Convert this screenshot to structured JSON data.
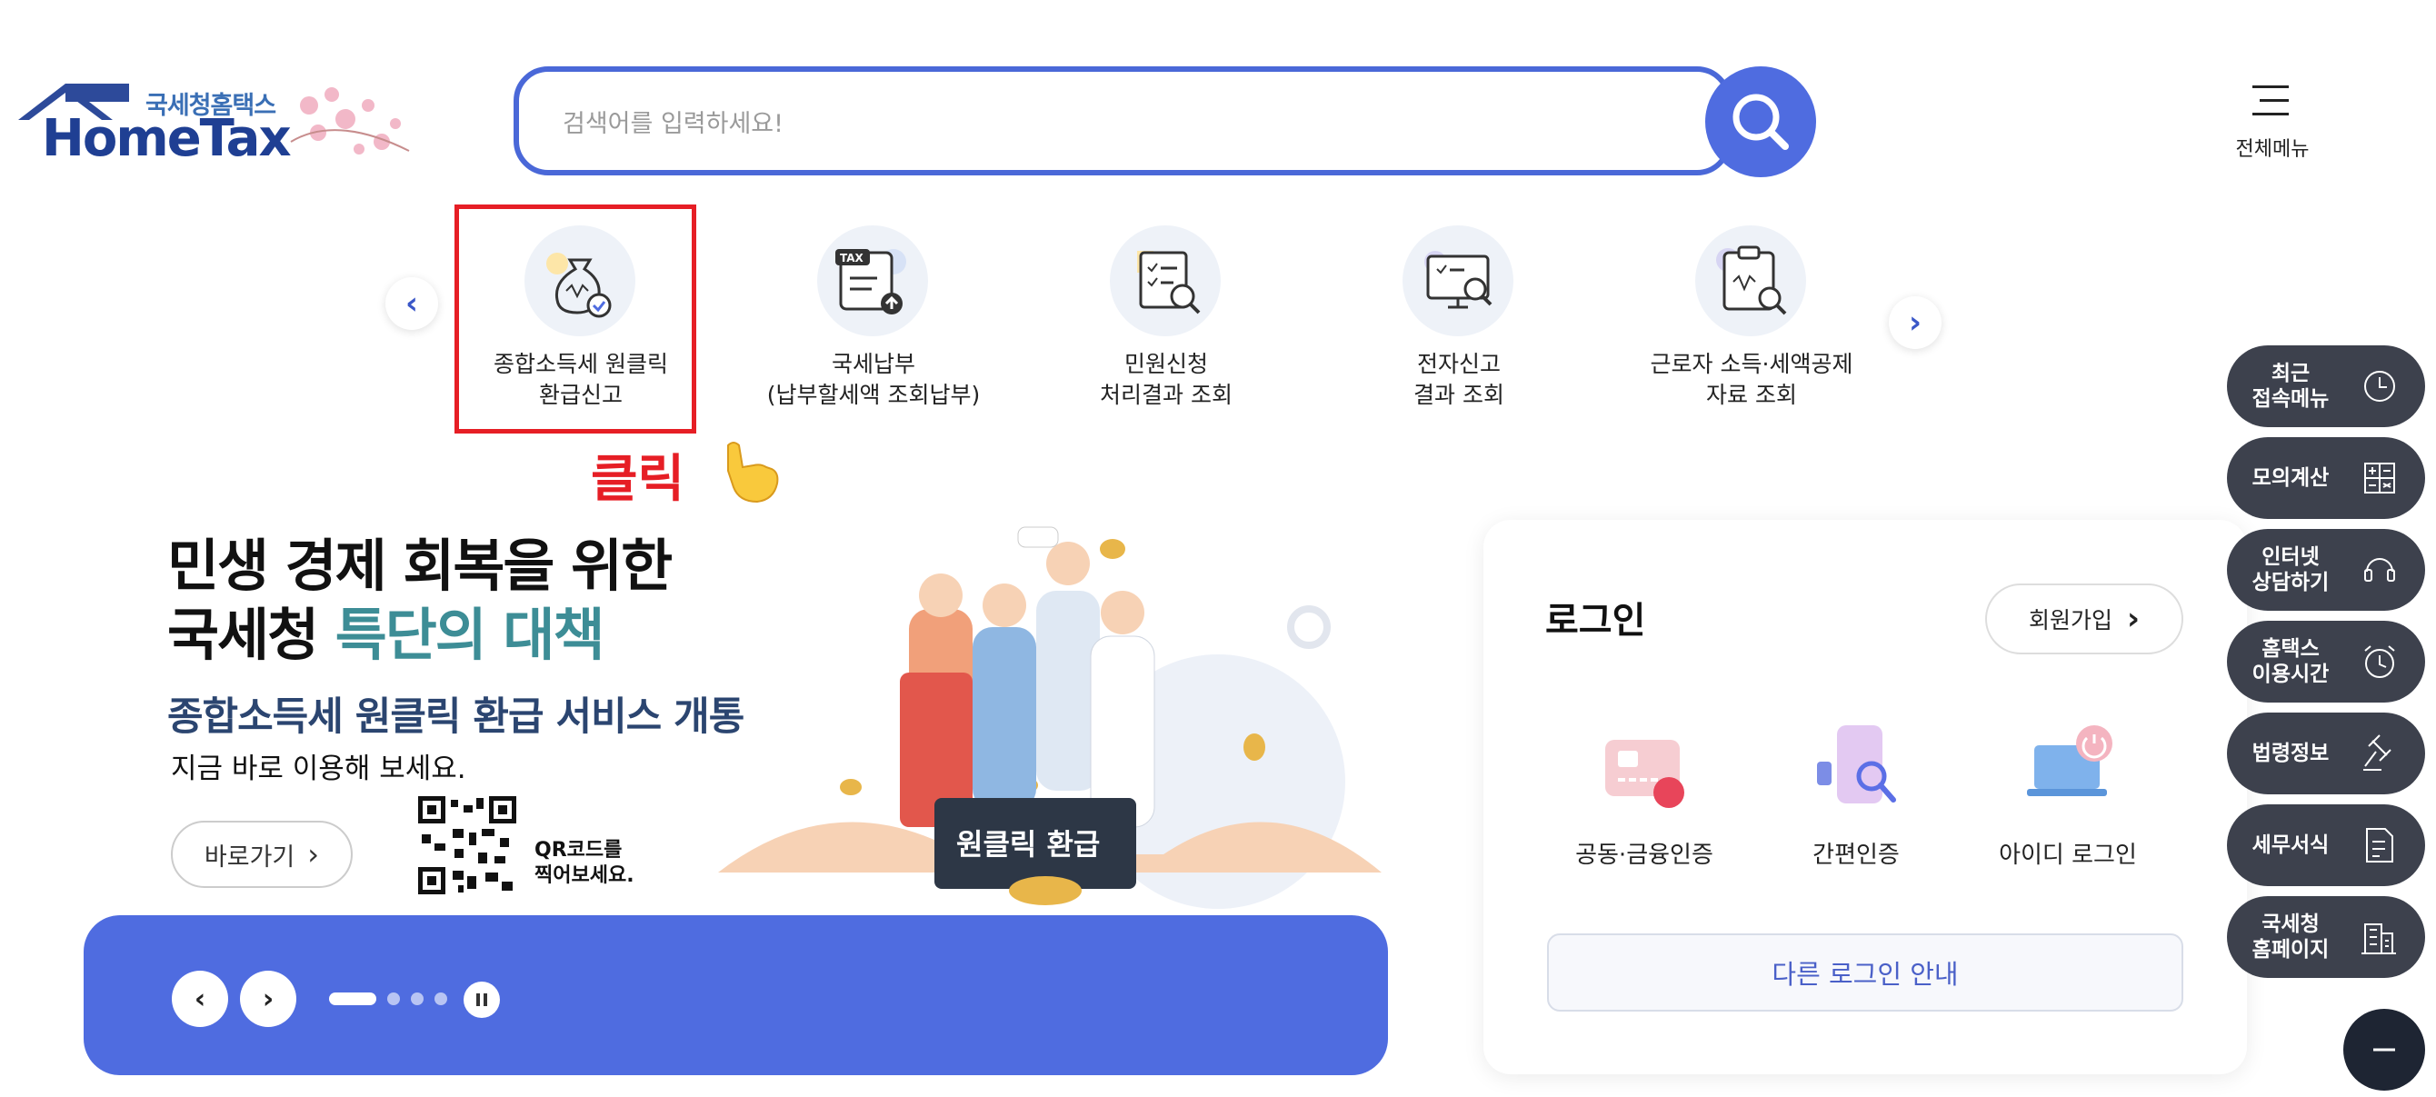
{
  "header": {
    "logo_small": "국세청홈택스",
    "logo_big": "HomeTax",
    "search_placeholder": "검색어를 입력하세요!",
    "full_menu_label": "전체메뉴"
  },
  "quick_menu": {
    "items": [
      {
        "line1": "종합소득세 원클릭",
        "line2": "환급신고",
        "icon": "money-bag-icon"
      },
      {
        "line1": "국세납부",
        "line2": "(납부할세액 조회납부)",
        "icon": "tax-upload-icon"
      },
      {
        "line1": "민원신청",
        "line2": "처리결과 조회",
        "icon": "document-search-icon"
      },
      {
        "line1": "전자신고",
        "line2": "결과 조회",
        "icon": "monitor-search-icon"
      },
      {
        "line1": "근로자 소득·세액공제",
        "line2": "자료 조회",
        "icon": "clipboard-search-icon"
      }
    ],
    "click_annotation": "클릭",
    "highlight_color": "#e61e25"
  },
  "banner": {
    "title_line1": "민생 경제 회복을 위한",
    "title_line2_a": "국세청 ",
    "title_line2_b": "특단의 대책",
    "subtitle": "종합소득세 원클릭 환급 서비스 개통",
    "description": "지금 바로 이용해 보세요.",
    "go_button": "바로가기",
    "qr_text_line1": "QR코드를",
    "qr_text_line2": "찍어보세요.",
    "sign_text": "원클릭 환급",
    "slide_index": 1,
    "slide_count": 4,
    "accent_color": "#4f6ce0"
  },
  "login": {
    "title": "로그인",
    "join_button": "회원가입",
    "methods": [
      {
        "label": "공동·금융인증",
        "icon": "certificate-card-icon"
      },
      {
        "label": "간편인증",
        "icon": "phone-search-icon"
      },
      {
        "label": "아이디 로그인",
        "icon": "laptop-power-icon"
      }
    ],
    "other_login": "다른 로그인 안내"
  },
  "side_menu": [
    {
      "line1": "최근",
      "line2": "접속메뉴",
      "icon": "clock-icon"
    },
    {
      "line1": "모의계산",
      "line2": "",
      "icon": "calculator-icon"
    },
    {
      "line1": "인터넷",
      "line2": "상담하기",
      "icon": "headset-icon"
    },
    {
      "line1": "홈택스",
      "line2": "이용시간",
      "icon": "alarm-clock-icon"
    },
    {
      "line1": "법령정보",
      "line2": "",
      "icon": "gavel-icon"
    },
    {
      "line1": "세무서식",
      "line2": "",
      "icon": "form-document-icon"
    },
    {
      "line1": "국세청",
      "line2": "홈페이지",
      "icon": "building-icon"
    }
  ]
}
